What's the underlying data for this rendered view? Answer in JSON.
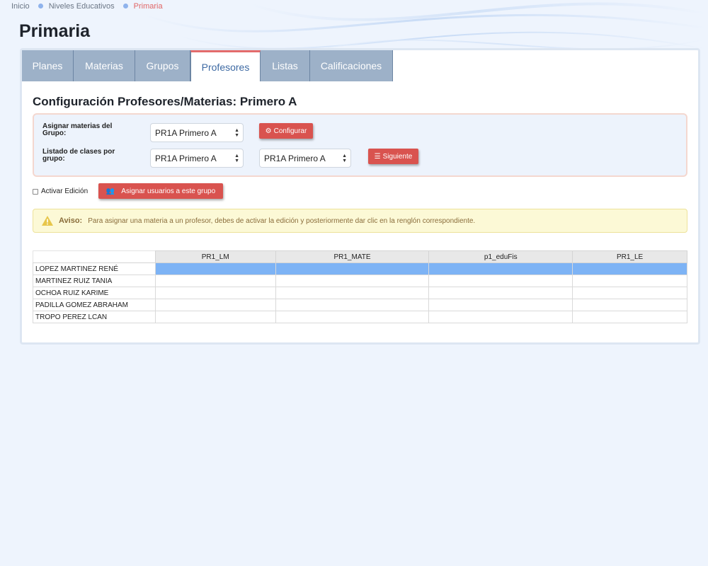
{
  "breadcrumb": {
    "items": [
      "Inicio",
      "Niveles Educativos",
      "Primaria"
    ]
  },
  "page_title": "Primaria",
  "tabs": [
    {
      "label": "Planes",
      "active": false
    },
    {
      "label": "Materias",
      "active": false
    },
    {
      "label": "Grupos",
      "active": false
    },
    {
      "label": "Profesores",
      "active": true
    },
    {
      "label": "Listas",
      "active": false
    },
    {
      "label": "Calificaciones",
      "active": false
    }
  ],
  "section_title": "Configuración Profesores/Materias: Primero A",
  "config": {
    "row1_label": "Asignar materias del Grupo:",
    "row1_select": "PR1A Primero A",
    "configure_button": "Configurar",
    "row2_label": "Listado de clases por grupo:",
    "row2_select_a": "PR1A Primero A",
    "row2_select_b": "PR1A Primero A",
    "next_button": "Siguiente"
  },
  "edit": {
    "checkbox_label": "Activar Edición",
    "assign_button": "Asignar usuarios a este grupo"
  },
  "alert": {
    "title": "Aviso:",
    "message": "Para asignar una materia a un profesor, debes de activar la edición y posteriormente dar clic en la renglón correspondiente."
  },
  "grid": {
    "columns": [
      "PR1_LM",
      "PR1_MATE",
      "p1_eduFis",
      "PR1_LE"
    ],
    "rows": [
      {
        "name": "LOPEZ MARTINEZ RENÉ",
        "selected": true
      },
      {
        "name": "MARTINEZ RUIZ TANIA",
        "selected": false
      },
      {
        "name": "OCHOA RUIZ KARIME",
        "selected": false
      },
      {
        "name": "PADILLA GOMEZ ABRAHAM",
        "selected": false
      },
      {
        "name": "TROPO PEREZ LCAN",
        "selected": false
      }
    ]
  },
  "colors": {
    "accent_red": "#d9534f",
    "tab_bg": "#9db1c8",
    "selected_row": "#7db3f5"
  }
}
